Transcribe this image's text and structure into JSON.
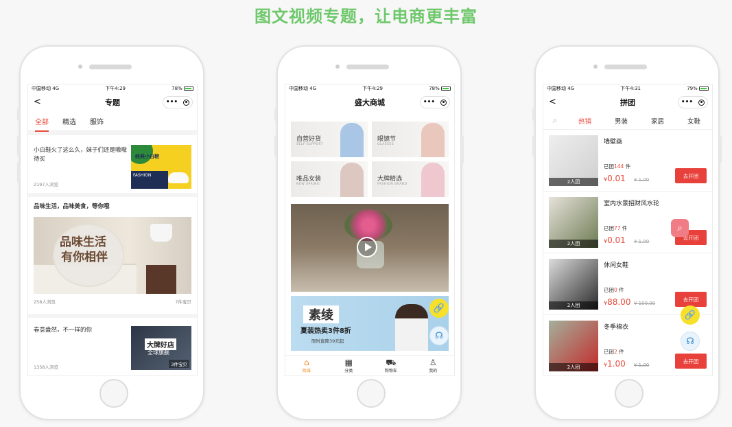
{
  "headline": "图文视频专题，让电商更丰富",
  "status_left": "中国移动  4G",
  "phone1": {
    "time": "下午4:29",
    "battery": "78%",
    "title": "专题",
    "tabs": [
      "全部",
      "精选",
      "服饰"
    ],
    "card1": {
      "text": "小白鞋火了这么久，妹子们还是嗷嗷待买",
      "views": "2197人浏览",
      "img_label": "经典小白鞋",
      "img_fashion": "FASHION"
    },
    "card2": {
      "title": "品味生活，品味美食，等你哦",
      "img_line1": "品味生活",
      "img_line2": "有你相伴",
      "views": "258人浏览",
      "items": "7件宝贝"
    },
    "card3": {
      "text": "春意盎然，不一样的你",
      "views": "1358人浏览",
      "img_line1": "大牌好店",
      "img_line2": "全球旗舰",
      "items": "3件宝贝"
    }
  },
  "phone2": {
    "time": "下午4:29",
    "battery": "78%",
    "title": "盛大商城",
    "grid": [
      {
        "title": "自营好货",
        "sub": "SELF-SUPPORT",
        "color": "#aac6e6"
      },
      {
        "title": "眼镜节",
        "sub": "GLASSES",
        "color": "#e9c7bd"
      },
      {
        "title": "唯品女装",
        "sub": "NEW SPRING",
        "color": "#dcc8c0"
      },
      {
        "title": "大牌精选",
        "sub": "FASHION BRAND",
        "color": "#efc7cf"
      }
    ],
    "banner": {
      "t1": "素绫",
      "t2": "夏装热卖3件8折",
      "t3": "限时直降39元起"
    },
    "tabbar": [
      {
        "label": "商城",
        "icon": "⌂"
      },
      {
        "label": "分类",
        "icon": "▦"
      },
      {
        "label": "购物车",
        "icon": "⛟"
      },
      {
        "label": "我的",
        "icon": "♙"
      }
    ]
  },
  "phone3": {
    "time": "下午4:31",
    "battery": "79%",
    "title": "拼团",
    "tabs": [
      "热销",
      "男装",
      "家居",
      "女鞋"
    ],
    "products": [
      {
        "name": "墙壁画",
        "count_prefix": "已团",
        "count": "144",
        "count_suffix": " 件",
        "currency": "¥",
        "price": "0.01",
        "old": "¥ 1.00",
        "tag": "2人团",
        "btn": "去开团",
        "c1": "#eeeeee",
        "c2": "#cfcfcf"
      },
      {
        "name": "室内水景招财风水轮",
        "count_prefix": "已团",
        "count": "77",
        "count_suffix": " 件",
        "currency": "¥",
        "price": "0.01",
        "old": "¥ 1.00",
        "tag": "2人团",
        "btn": "去开团",
        "c1": "#e6e2da",
        "c2": "#6c7b52"
      },
      {
        "name": "休闲女鞋",
        "count_prefix": "已团",
        "count": "0",
        "count_suffix": " 件",
        "currency": "¥",
        "price": "88.00",
        "old": "¥ 100.00",
        "tag": "2人团",
        "btn": "去开团",
        "c1": "#dcdcdc",
        "c2": "#2a2a2a"
      },
      {
        "name": "冬季棉衣",
        "count_prefix": "已团",
        "count": "2",
        "count_suffix": " 件",
        "currency": "¥",
        "price": "1.00",
        "old": "¥ 1.00",
        "tag": "2人团",
        "btn": "去开团",
        "c1": "#a4b09c",
        "c2": "#c32a2a"
      }
    ]
  }
}
